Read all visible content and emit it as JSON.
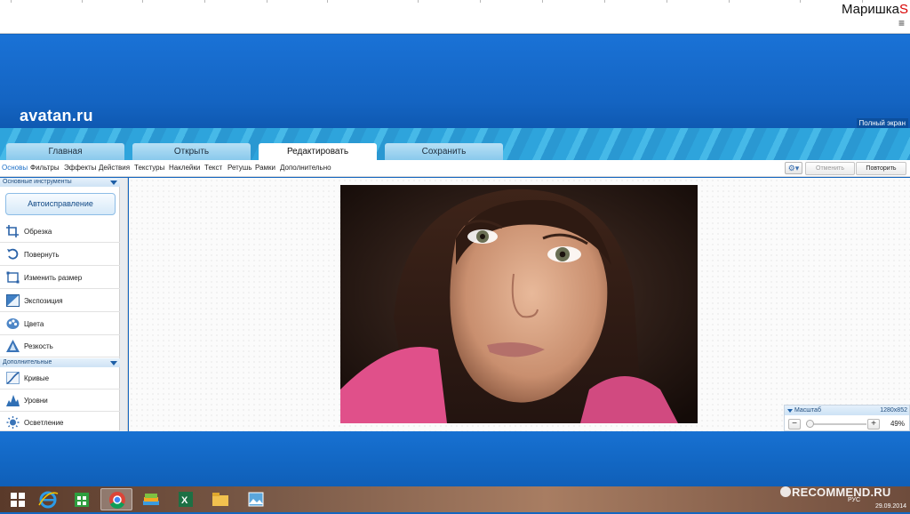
{
  "topbar": {
    "user_name": "Маришка",
    "user_suffix": "S",
    "menu_glyph": "≡"
  },
  "site": {
    "brand": "avatan.ru",
    "fullscreen_label": "Полный экран"
  },
  "tabs": [
    {
      "label": "Главная"
    },
    {
      "label": "Открыть"
    },
    {
      "label": "Редактировать",
      "active": true
    },
    {
      "label": "Сохранить"
    }
  ],
  "subtabs": [
    {
      "label": "Основы",
      "active": true
    },
    {
      "label": "Фильтры"
    },
    {
      "label": "Эффекты"
    },
    {
      "label": "Действия"
    },
    {
      "label": "Текстуры"
    },
    {
      "label": "Наклейки"
    },
    {
      "label": "Текст"
    },
    {
      "label": "Ретушь"
    },
    {
      "label": "Рамки"
    },
    {
      "label": "Дополнительно"
    }
  ],
  "toolbar": {
    "gear_icon": "gear-icon",
    "undo_label": "Отменить",
    "redo_label": "Повторить"
  },
  "sidebar": {
    "basic_header": "Основные инструменты",
    "auto_button": "Автоисправление",
    "basic_tools": [
      {
        "label": "Обрезка",
        "icon": "crop-icon"
      },
      {
        "label": "Повернуть",
        "icon": "rotate-icon"
      },
      {
        "label": "Изменить размер",
        "icon": "resize-icon"
      },
      {
        "label": "Экспозиция",
        "icon": "exposure-icon"
      },
      {
        "label": "Цвета",
        "icon": "palette-icon"
      },
      {
        "label": "Резкость",
        "icon": "sharpness-icon"
      }
    ],
    "extra_header": "Дополнительные",
    "extra_tools": [
      {
        "label": "Кривые",
        "icon": "curves-icon"
      },
      {
        "label": "Уровни",
        "icon": "levels-icon"
      },
      {
        "label": "Осветление",
        "icon": "lighten-icon"
      }
    ]
  },
  "zoom": {
    "label": "Масштаб",
    "resolution": "1280x852",
    "percent": "49%",
    "minus": "−",
    "plus": "+"
  },
  "taskbar": {
    "apps": [
      "windows-start-icon",
      "internet-explorer-icon",
      "store-icon",
      "chrome-icon",
      "bluestacks-icon",
      "excel-icon",
      "file-explorer-icon",
      "photos-icon"
    ],
    "lang": "РУС",
    "date": "29.09.2014"
  },
  "watermark": {
    "text": "RECOMMEND.RU"
  },
  "colors": {
    "accent_blue": "#1466c0",
    "water": "#2fa6de",
    "active_subtab": "#1c6fc7"
  }
}
